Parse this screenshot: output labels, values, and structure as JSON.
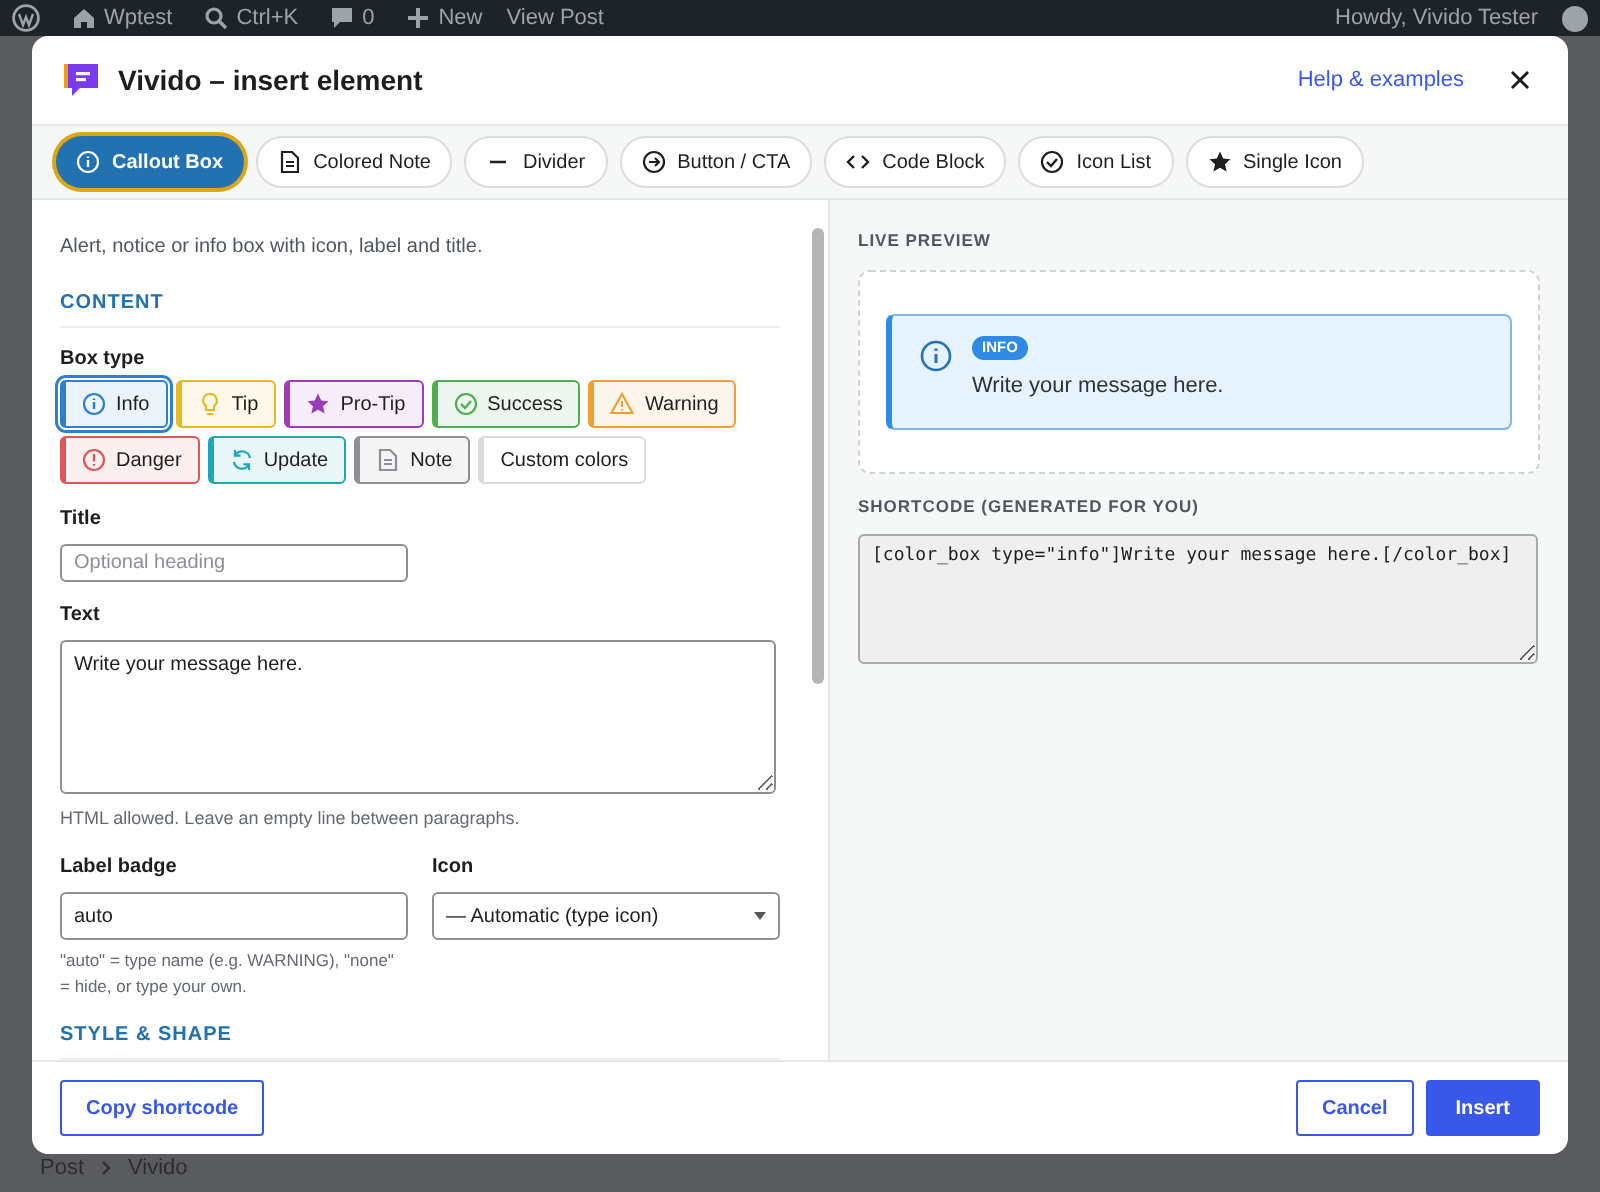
{
  "admin_bar": {
    "site": "Wptest",
    "search": "Ctrl+K",
    "comments": "0",
    "new": "New",
    "view": "View Post",
    "greeting": "Howdy, Vivido Tester"
  },
  "dialog": {
    "title": "Vivido – insert element",
    "help_link": "Help & examples"
  },
  "tabs": [
    {
      "label": "Callout Box",
      "selected": true
    },
    {
      "label": "Colored Note",
      "selected": false
    },
    {
      "label": "Divider",
      "selected": false
    },
    {
      "label": "Button / CTA",
      "selected": false
    },
    {
      "label": "Code Block",
      "selected": false
    },
    {
      "label": "Icon List",
      "selected": false
    },
    {
      "label": "Single Icon",
      "selected": false
    }
  ],
  "form": {
    "description": "Alert, notice or info box with icon, label and title.",
    "section_content": "CONTENT",
    "box_type_label": "Box type",
    "box_types": [
      {
        "label": "Info",
        "selected": true,
        "color": "#2f7fd1"
      },
      {
        "label": "Tip",
        "selected": false,
        "color": "#e9b824"
      },
      {
        "label": "Pro-Tip",
        "selected": false,
        "color": "#9b3db8"
      },
      {
        "label": "Success",
        "selected": false,
        "color": "#4caf50"
      },
      {
        "label": "Warning",
        "selected": false,
        "color": "#f0a030"
      },
      {
        "label": "Danger",
        "selected": false,
        "color": "#e05555"
      },
      {
        "label": "Update",
        "selected": false,
        "color": "#1fa7b8"
      },
      {
        "label": "Note",
        "selected": false,
        "color": "#8c8f94"
      },
      {
        "label": "Custom colors",
        "selected": false,
        "color": "#dcdcde"
      }
    ],
    "title_label": "Title",
    "title_placeholder": "Optional heading",
    "text_label": "Text",
    "text_value": "Write your message here.",
    "text_hint": "HTML allowed. Leave an empty line between paragraphs.",
    "badge_label": "Label badge",
    "badge_value": "auto",
    "badge_hint": "\"auto\" = type name (e.g. WARNING), \"none\" = hide, or type your own.",
    "icon_label": "Icon",
    "icon_value": "— Automatic (type icon)",
    "section_style": "STYLE & SHAPE"
  },
  "preview": {
    "heading": "LIVE PREVIEW",
    "badge": "INFO",
    "message": "Write your message here.",
    "shortcode_label": "SHORTCODE (GENERATED FOR YOU)",
    "shortcode": "[color_box type=\"info\"]Write your message here.[/color_box]"
  },
  "footer": {
    "copy": "Copy shortcode",
    "cancel": "Cancel",
    "insert": "Insert"
  },
  "breadcrumb": [
    "Post",
    "Vivido"
  ]
}
